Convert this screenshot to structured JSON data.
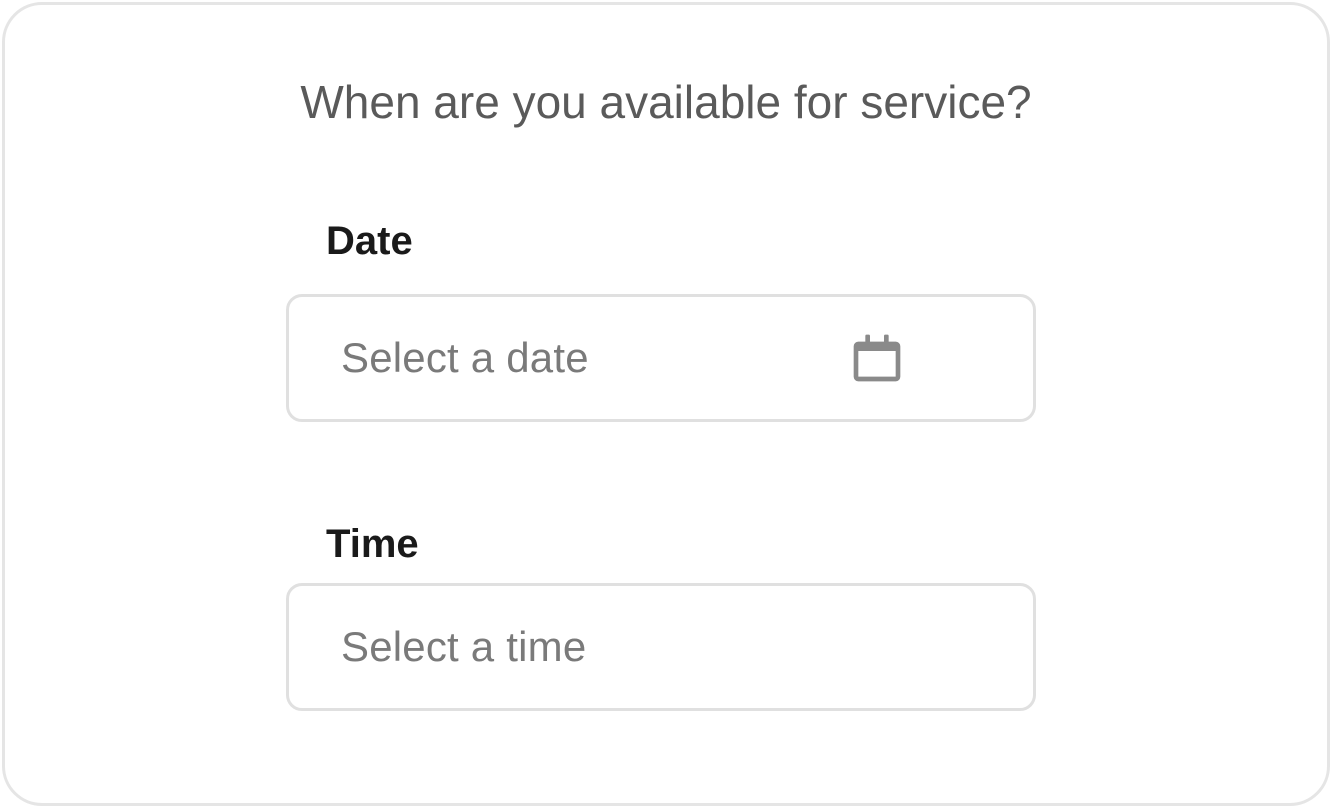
{
  "title": "When are you available for service?",
  "fields": {
    "date": {
      "label": "Date",
      "placeholder": "Select a date"
    },
    "time": {
      "label": "Time",
      "placeholder": "Select a time"
    }
  }
}
